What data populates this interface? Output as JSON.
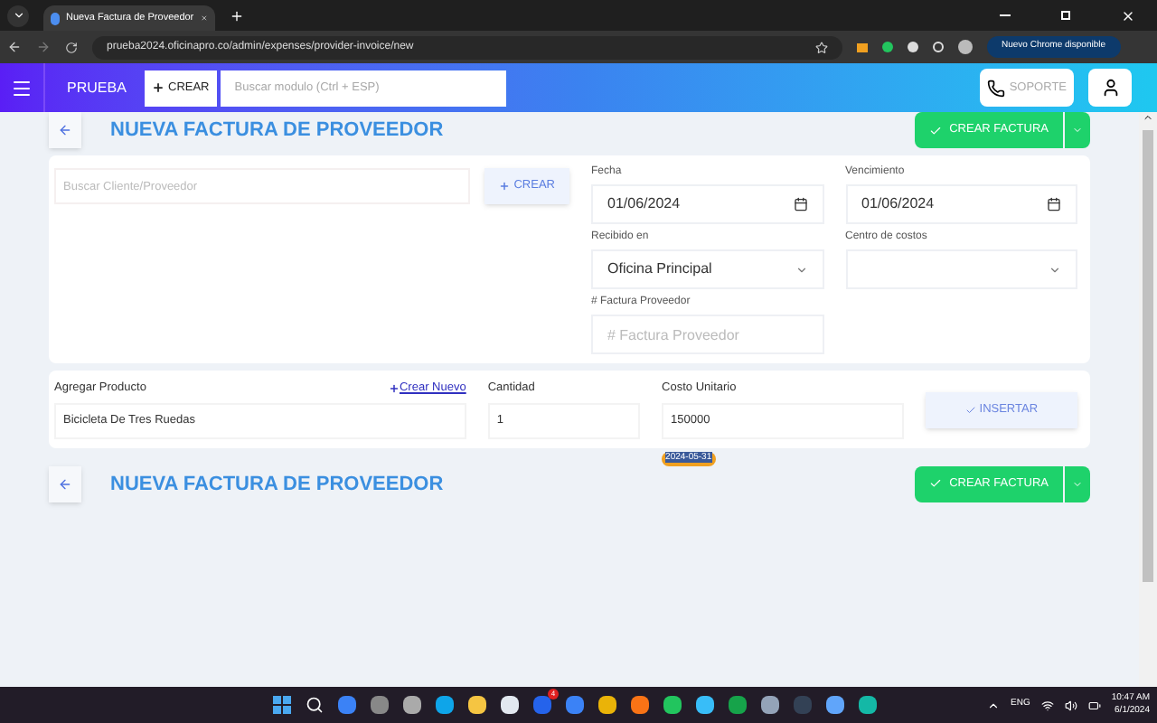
{
  "browser": {
    "tab_title": "Nueva Factura de Proveedor",
    "url": "prueba2024.oficinapro.co/admin/expenses/provider-invoice/new",
    "update_button": "Nuevo Chrome disponible"
  },
  "header": {
    "brand": "PRUEBA",
    "create_button": "CREAR",
    "search_placeholder": "Buscar modulo (Ctrl + ESP)",
    "support_button": "SOPORTE"
  },
  "top_bar": {
    "title": "NUEVA FACTURA DE PROVEEDOR",
    "create_invoice_button": "CREAR FACTURA"
  },
  "invoice_form": {
    "client_placeholder": "Buscar Cliente/Proveedor",
    "create_button": "CREAR",
    "fields": [
      {
        "kind": "date",
        "label": "Fecha",
        "value": "01/06/2024"
      },
      {
        "kind": "date",
        "label": "Vencimiento",
        "value": "01/06/2024"
      },
      {
        "kind": "select",
        "label": "Recibido en",
        "value": "Oficina Principal"
      },
      {
        "kind": "select",
        "label": "Centro de costos"
      },
      {
        "kind": "text",
        "label": "# Factura Proveedor",
        "placeholder": "# Factura Proveedor"
      }
    ]
  },
  "product_row": {
    "product_label": "Agregar Producto",
    "new_link": "Crear Nuevo",
    "product_value": "Bicicleta De Tres Ruedas",
    "quantity_label": "Cantidad",
    "quantity_value": "1",
    "cost_label": "Costo Unitario",
    "cost_value": "150000",
    "autofill_chip": "2024-05-31",
    "insert_button": "INSERTAR"
  },
  "bottom_bar": {
    "title": "NUEVA FACTURA DE PROVEEDOR",
    "create_invoice_button": "CREAR FACTURA"
  },
  "taskbar": {
    "badge": "4",
    "language": "ENG",
    "time": "10:47 AM",
    "date": "6/1/2024"
  }
}
